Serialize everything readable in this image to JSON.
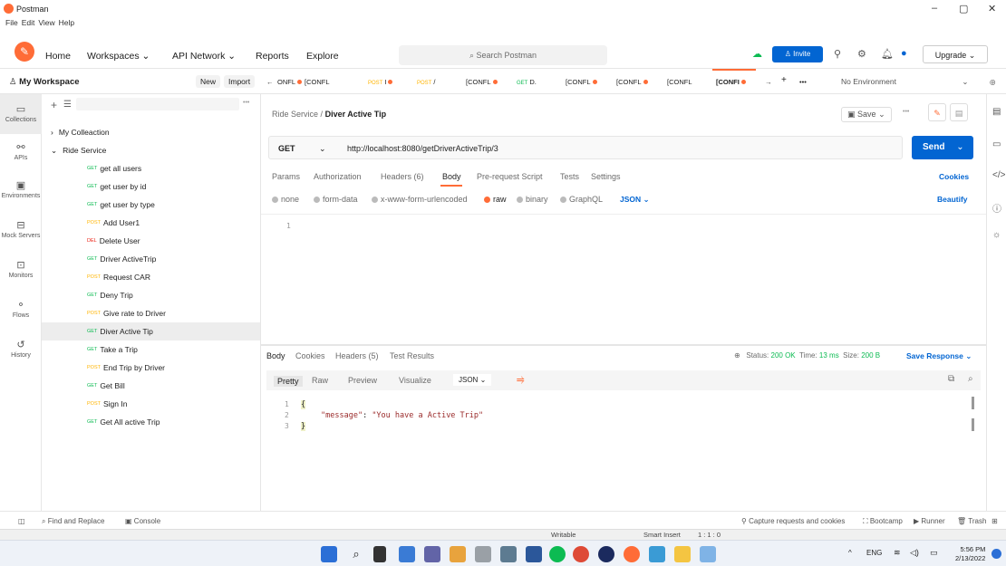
{
  "window": {
    "title": "Postman",
    "menu": [
      "File",
      "Edit",
      "View",
      "Help"
    ]
  },
  "header": {
    "nav": [
      "Home",
      "Workspaces",
      "API Network",
      "Reports",
      "Explore"
    ],
    "search_placeholder": "Search Postman",
    "invite": "Invite",
    "upgrade": "Upgrade"
  },
  "workspace": {
    "title": "My Workspace",
    "new": "New",
    "import": "Import"
  },
  "tabs": [
    {
      "method": "",
      "label": "ONFL"
    },
    {
      "method": "",
      "label": "[CONFL"
    },
    {
      "method": "POST",
      "label": "I"
    },
    {
      "method": "POST",
      "label": "/"
    },
    {
      "method": "",
      "label": "[CONFL"
    },
    {
      "method": "GET",
      "label": "D."
    },
    {
      "method": "",
      "label": "[CONFL"
    },
    {
      "method": "",
      "label": "[CONFL"
    },
    {
      "method": "",
      "label": "[CONFL"
    },
    {
      "method": "",
      "label": "[CONFI"
    }
  ],
  "environment": "No Environment",
  "rail": [
    "Collections",
    "APIs",
    "Environments",
    "Mock Servers",
    "Monitors",
    "Flows",
    "History"
  ],
  "sidebar": {
    "collections": [
      "My Colleaction",
      "Ride Service"
    ],
    "items": [
      {
        "method": "GET",
        "label": "get all users"
      },
      {
        "method": "GET",
        "label": "get user by id"
      },
      {
        "method": "GET",
        "label": "get user by type"
      },
      {
        "method": "POST",
        "label": "Add User1"
      },
      {
        "method": "DEL",
        "label": "Delete User"
      },
      {
        "method": "GET",
        "label": "Driver ActiveTrip"
      },
      {
        "method": "POST",
        "label": "Request CAR"
      },
      {
        "method": "GET",
        "label": "Deny Trip"
      },
      {
        "method": "POST",
        "label": "Give rate to Driver"
      },
      {
        "method": "GET",
        "label": "Diver Active Tip"
      },
      {
        "method": "GET",
        "label": "Take a Trip"
      },
      {
        "method": "POST",
        "label": "End Trip by Driver"
      },
      {
        "method": "GET",
        "label": "Get Bill"
      },
      {
        "method": "POST",
        "label": "Sign In"
      },
      {
        "method": "GET",
        "label": "Get All active Trip"
      }
    ]
  },
  "request": {
    "breadcrumb_parent": "Ride Service",
    "breadcrumb_sep": "/",
    "breadcrumb_name": "Diver Active Tip",
    "save": "Save",
    "method": "GET",
    "url": "http://localhost:8080/getDriverActiveTrip/3",
    "send": "Send",
    "tabs": [
      "Params",
      "Authorization",
      "Headers (6)",
      "Body",
      "Pre-request Script",
      "Tests",
      "Settings"
    ],
    "cookies": "Cookies",
    "body_types": [
      "none",
      "form-data",
      "x-www-form-urlencoded",
      "raw",
      "binary",
      "GraphQL"
    ],
    "body_format": "JSON",
    "beautify": "Beautify",
    "line1": "1"
  },
  "response": {
    "tabs": [
      "Body",
      "Cookies",
      "Headers (5)",
      "Test Results"
    ],
    "status_label": "Status:",
    "status_value": "200 OK",
    "time_label": "Time:",
    "time_value": "13 ms",
    "size_label": "Size:",
    "size_value": "200 B",
    "save_response": "Save Response",
    "views": [
      "Pretty",
      "Raw",
      "Preview",
      "Visualize"
    ],
    "format": "JSON",
    "lines": [
      "1",
      "2",
      "3"
    ],
    "open_brace": "{",
    "key": "\"message\"",
    "colon": ":",
    "value": "\"You have a Active Trip\"",
    "close_brace": "}"
  },
  "footer": {
    "find": "Find and Replace",
    "console": "Console",
    "capture": "Capture requests and cookies",
    "bootcamp": "Bootcamp",
    "runner": "Runner",
    "trash": "Trash"
  },
  "strip": {
    "writable": "Writable",
    "smart_insert": "Smart Insert",
    "position": "1 : 1 : 0"
  },
  "taskbar": {
    "lang": "ENG",
    "time": "5:56 PM",
    "date": "2/13/2022"
  },
  "colors": {
    "accent": "#ff6c37",
    "primary": "#0265d2",
    "get": "#0cbb52",
    "post": "#ffb400",
    "delete": "#eb2013"
  }
}
